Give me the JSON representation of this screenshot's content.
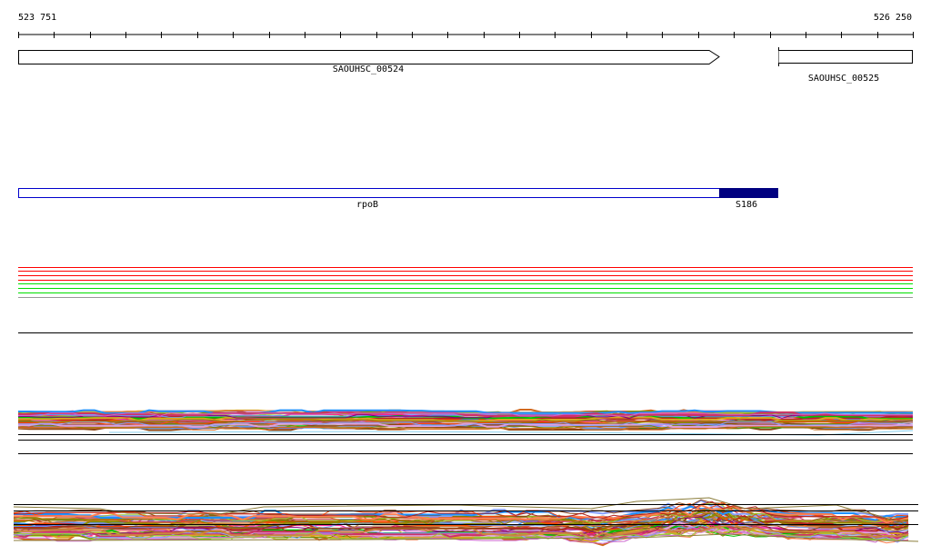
{
  "ruler": {
    "start_label": "523 751",
    "end_label": "526 250",
    "tick_count": 25
  },
  "genes": [
    {
      "name": "SAOUHSC_00524",
      "strand": "+"
    },
    {
      "name": "SAOUHSC_00525",
      "strand": "partial"
    }
  ],
  "feature": {
    "name": "rpoB",
    "mutation_label": "S186",
    "outline_color": "#0000cc",
    "fill_color": "#000080"
  },
  "flat_tracks": {
    "colors": [
      "#ff0000",
      "#ff0000",
      "#ff0000",
      "#ff0000",
      "#00e000",
      "#00e000",
      "#00e000"
    ]
  },
  "coverage_palette": [
    "#d2691e",
    "#8b8b00",
    "#cc3366",
    "#cc66cc",
    "#87a0ff",
    "#ff7f50",
    "#9acd32",
    "#b22222",
    "#cd853f",
    "#8b4513",
    "#00c000",
    "#ff1493",
    "#6495ed",
    "#daa520",
    "#800080",
    "#808000",
    "#1e90ff",
    "#a0522d",
    "#ff4500",
    "#dda0dd"
  ]
}
